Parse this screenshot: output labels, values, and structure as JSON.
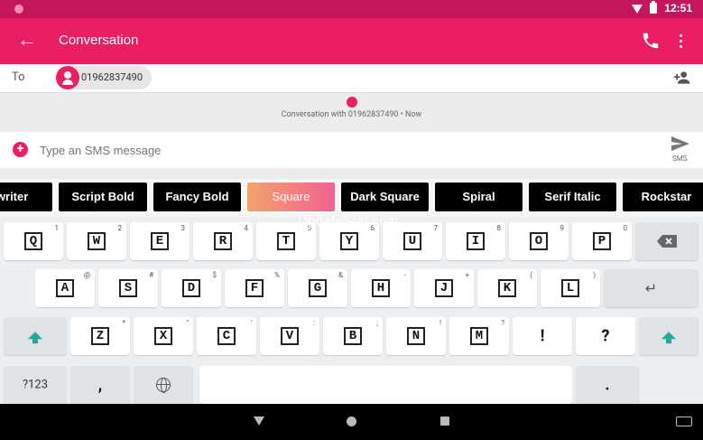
{
  "status": {
    "time": "12:51"
  },
  "app_bar": {
    "title": "Conversation"
  },
  "recipient": {
    "to_label": "To",
    "chip_number": "01962837490"
  },
  "conversation": {
    "info": "Conversation with 01962837490 • Now"
  },
  "compose": {
    "placeholder": "Type an SMS message",
    "send_label": "SMS"
  },
  "font_styles": [
    "Typewriter",
    "Script Bold",
    "Fancy Bold",
    "Square",
    "Dark Square",
    "Spiral",
    "Serif Italic",
    "Rockstar"
  ],
  "font_styles_visible": [
    "ewriter",
    "Script Bold",
    "Fancy Bold",
    "Square",
    "Dark Square",
    "Spiral",
    "Serif Italic",
    "Rockstar"
  ],
  "active_font_style": "Square",
  "watermark": "UpdateStar.com",
  "keyboard": {
    "row1": [
      {
        "key": "Q",
        "hint": "1"
      },
      {
        "key": "W",
        "hint": "2"
      },
      {
        "key": "E",
        "hint": "3"
      },
      {
        "key": "R",
        "hint": "4"
      },
      {
        "key": "T",
        "hint": "5"
      },
      {
        "key": "Y",
        "hint": "6"
      },
      {
        "key": "U",
        "hint": "7"
      },
      {
        "key": "I",
        "hint": "8"
      },
      {
        "key": "O",
        "hint": "9"
      },
      {
        "key": "P",
        "hint": "0"
      }
    ],
    "row2": [
      {
        "key": "A",
        "hint": "@"
      },
      {
        "key": "S",
        "hint": "#"
      },
      {
        "key": "D",
        "hint": "$"
      },
      {
        "key": "F",
        "hint": "%"
      },
      {
        "key": "G",
        "hint": "&"
      },
      {
        "key": "H",
        "hint": "-"
      },
      {
        "key": "J",
        "hint": "+"
      },
      {
        "key": "K",
        "hint": "("
      },
      {
        "key": "L",
        "hint": ")"
      }
    ],
    "row3": [
      {
        "key": "Z",
        "hint": "*"
      },
      {
        "key": "X",
        "hint": "\""
      },
      {
        "key": "C",
        "hint": "'"
      },
      {
        "key": "V",
        "hint": ":"
      },
      {
        "key": "B",
        "hint": ";"
      },
      {
        "key": "N",
        "hint": "!"
      },
      {
        "key": "M",
        "hint": "?"
      }
    ],
    "row3_extra": [
      "!",
      "?"
    ],
    "symbols_label": "?123",
    "comma": ",",
    "period": "."
  },
  "icons": [
    "back-arrow-icon",
    "phone-icon",
    "more-vert-icon",
    "add-person-icon",
    "plus-icon",
    "send-icon",
    "backspace-icon",
    "enter-icon",
    "shift-icon",
    "globe-icon"
  ],
  "colors": {
    "primary": "#e91e63",
    "primary_dark": "#c2185b",
    "shift_accent": "#26a69a"
  }
}
